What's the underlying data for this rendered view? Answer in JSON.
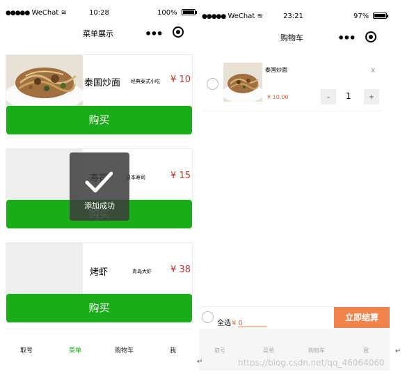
{
  "left_phone": {
    "status": {
      "carrier": "WeChat",
      "time": "10:28",
      "battery": "100%",
      "battery_level": 1.0
    },
    "nav_title": "菜单展示",
    "items": [
      {
        "name": "泰国炒面",
        "desc": "经典泰式小吃",
        "price": "¥ 10",
        "buy_label": "购买"
      },
      {
        "name": "寿司",
        "desc": "日本寿司",
        "price": "¥ 15",
        "buy_label": "购买"
      },
      {
        "name": "烤虾",
        "desc": "青岛大虾",
        "price": "¥ 38",
        "buy_label": "购买"
      }
    ],
    "toast": {
      "text": "添加成功"
    },
    "tabs": [
      {
        "label": "取号"
      },
      {
        "label": "菜单"
      },
      {
        "label": "购物车"
      },
      {
        "label": "我"
      }
    ],
    "active_tab_color": "#1aad19"
  },
  "right_phone": {
    "status": {
      "carrier": "WeChat",
      "time": "23:21",
      "battery": "97%",
      "battery_level": 0.97
    },
    "nav_title": "购物车",
    "cart_item": {
      "name": "泰国炒面",
      "price": "¥ 10.00",
      "remove": "x",
      "minus": "-",
      "quantity": "1",
      "plus": "+"
    },
    "bottom_bar": {
      "select_all": "全选",
      "total": "¥ 0",
      "checkout": "立即结算"
    },
    "tabs": [
      {
        "label": "取号"
      },
      {
        "label": "菜单"
      },
      {
        "label": "购物车"
      },
      {
        "label": "我"
      }
    ],
    "checkout_color": "#f0844c"
  },
  "watermark": "https://blog.csdn.net/qq_46064060",
  "return_mark": "↵"
}
